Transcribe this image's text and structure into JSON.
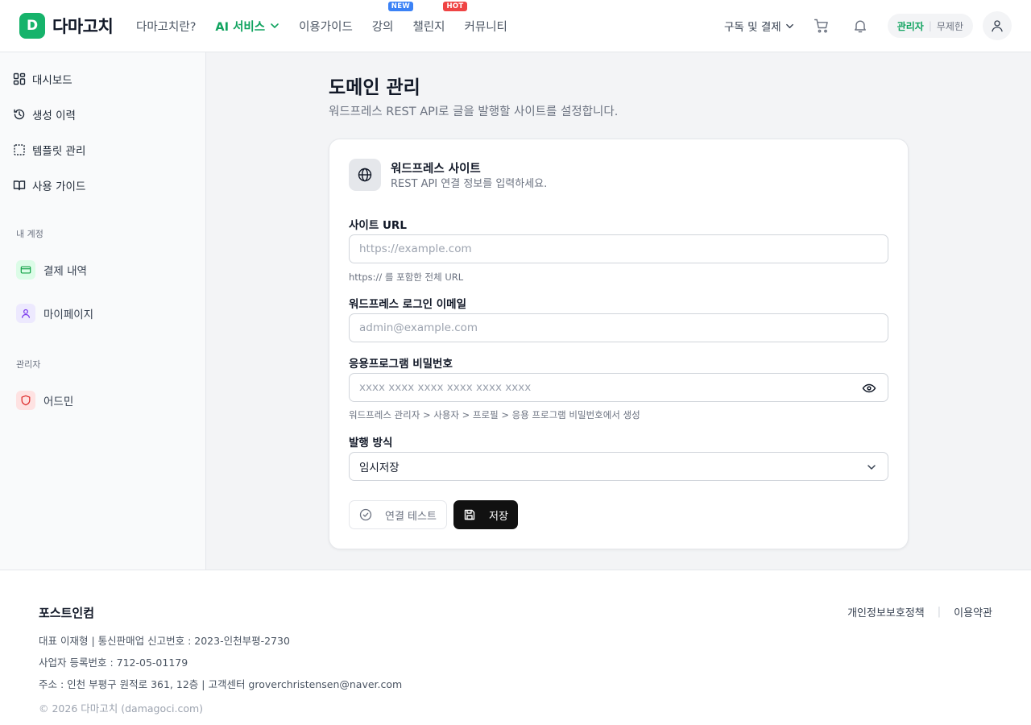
{
  "header": {
    "logo_mark": "D",
    "logo_text": "다마고치",
    "nav": [
      {
        "label": "다마고치란?"
      },
      {
        "label": "AI 서비스"
      },
      {
        "label": "이용가이드"
      },
      {
        "label": "강의",
        "badge": "NEW"
      },
      {
        "label": "챌린지",
        "badge": "HOT"
      },
      {
        "label": "커뮤니티"
      }
    ],
    "subscribe_label": "구독 및 결제",
    "role_primary": "관리자",
    "role_separator": "|",
    "role_secondary": "무제한"
  },
  "sidebar": {
    "items": [
      {
        "label": "대시보드",
        "icon": "grid-icon"
      },
      {
        "label": "생성 이력",
        "icon": "history-icon"
      },
      {
        "label": "템플릿 관리",
        "icon": "template-icon"
      },
      {
        "label": "사용 가이드",
        "icon": "book-icon"
      }
    ],
    "section_account": "내 계정",
    "account_items": [
      {
        "label": "결제 내역",
        "icon": "card-icon"
      },
      {
        "label": "마이페이지",
        "icon": "user-icon"
      }
    ],
    "section_admin": "관리자",
    "admin_items": [
      {
        "label": "어드민",
        "icon": "shield-icon"
      }
    ]
  },
  "main": {
    "title": "도메인 관리",
    "subtitle": "워드프레스 REST API로 글을 발행할 사이트를 설정합니다.",
    "card": {
      "title": "워드프레스 사이트",
      "description": "REST API 연결 정보를 입력하세요.",
      "site_url_label": "사이트 URL",
      "site_url_placeholder": "https://example.com",
      "site_url_hint": "https:// 를 포함한 전체 URL",
      "email_label": "워드프레스 로그인 이메일",
      "email_placeholder": "admin@example.com",
      "password_label": "응용프로그램 비밀번호",
      "password_placeholder": "xxxx xxxx xxxx xxxx xxxx xxxx",
      "password_hint": "워드프레스 관리자 > 사용자 > 프로필 > 응용 프로그램 비밀번호에서 생성",
      "publish_label": "발행 방식",
      "publish_value": "임시저장",
      "test_button": "연결 테스트",
      "save_button": "저장"
    }
  },
  "footer": {
    "company": "포스트인컴",
    "line1": "대표 이재형 | 통신판매업 신고번호 : 2023-인천부평-2730",
    "line2": "사업자 등록번호 : 712-05-01179",
    "line3": "주소 : 인천 부평구 원적로 361, 12층 | 고객센터 groverchristensen@naver.com",
    "copyright": "© 2026 다마고치 (damagoci.com)",
    "privacy_link": "개인정보보호정책",
    "terms_link": "이용약관",
    "links_separator": "|"
  },
  "colors": {
    "brand": "#16b36b",
    "active_nav": "#10a35f",
    "badge_new": "#3b82f6",
    "badge_hot": "#ef4444",
    "save_button": "#111111"
  }
}
